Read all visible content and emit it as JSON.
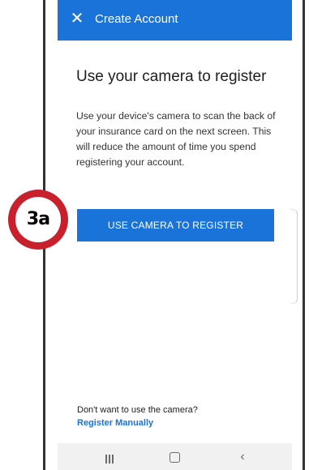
{
  "app_bar": {
    "title": "Create Account",
    "close_icon": "close-icon"
  },
  "main": {
    "title": "Use your camera to register",
    "description": "Use your device's camera to scan the back of your insurance card on the next screen. This will reduce the amount of time you spend registering your account.",
    "camera_button_label": "USE CAMERA TO REGISTER"
  },
  "annotation": {
    "badge_label": "3a"
  },
  "footer": {
    "prompt": "Don't want to use the camera?",
    "manual_link": "Register Manually"
  },
  "nav_bar": {
    "recents_icon": "recents-icon",
    "home_icon": "home-icon",
    "back_icon": "back-icon"
  },
  "colors": {
    "primary": "#1a73d9",
    "badge_ring": "#c9202d"
  }
}
